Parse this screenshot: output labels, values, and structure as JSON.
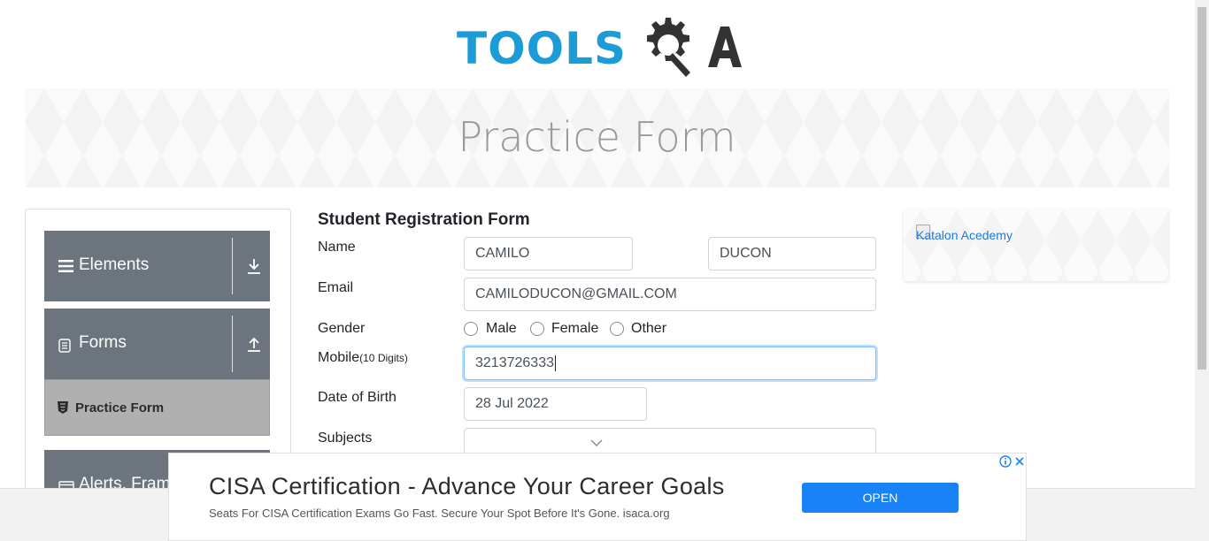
{
  "logo": {
    "text_tools": "TOOLS",
    "text_a": "A",
    "colors": {
      "tools": "#1b9cd7",
      "qa": "#333333"
    }
  },
  "banner": {
    "title": "Practice Form"
  },
  "sidebar": {
    "groups": [
      {
        "label": "Elements",
        "icon": "hamburger-icon",
        "arrow": "download-arrow-icon"
      },
      {
        "label": "Forms",
        "icon": "document-icon",
        "arrow": "upload-arrow-icon"
      },
      {
        "label": "Alerts, Fram",
        "icon": "window-icon"
      }
    ],
    "active_item": {
      "label": "Practice Form",
      "icon": "html5-icon"
    }
  },
  "form": {
    "title": "Student Registration Form",
    "name_label": "Name",
    "first_name": "CAMILO",
    "last_name": "DUCON",
    "email_label": "Email",
    "email": "CAMILODUCON@GMAIL.COM",
    "gender_label": "Gender",
    "gender_options": [
      "Male",
      "Female",
      "Other"
    ],
    "mobile_label": "Mobile",
    "mobile_hint": "(10 Digits)",
    "mobile": "3213726333",
    "dob_label": "Date of Birth",
    "dob": "28 Jul 2022",
    "subjects_label": "Subjects"
  },
  "side_ad": {
    "alt_text": "Katalon Acedemy"
  },
  "ad": {
    "title": "CISA Certification - Advance Your Career Goals",
    "subtitle": "Seats For CISA Certification Exams Go Fast. Secure Your Spot Before It's Gone. isaca.org",
    "button": "OPEN",
    "accent": "#1a82f7"
  }
}
